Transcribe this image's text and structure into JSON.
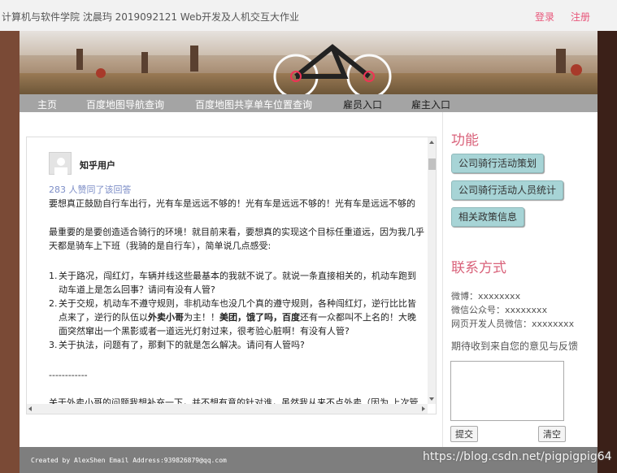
{
  "header": {
    "site_title": "计算机与软件学院 沈晨玙 2019092121 Web开发及人机交互大作业",
    "login": "登录",
    "register": "注册"
  },
  "banner": {
    "image_icon": "cycling-landscape-banner"
  },
  "nav": {
    "items": [
      {
        "label": "主页"
      },
      {
        "label": "百度地图导航查询"
      },
      {
        "label": "百度地图共享单车位置查询"
      },
      {
        "label": "雇员入口"
      },
      {
        "label": "雇主入口"
      }
    ]
  },
  "article": {
    "author": "知乎用户",
    "votes": "283 人赞同了该回答",
    "p1": "要想真正鼓励自行车出行，光有车是远远不够的！光有车是远远不够的！光有车是远远不够的",
    "p2_line1": "最重要的是要创造适合骑行的环境！就目前来看，要想真的实现这个目标任重道远，因为我几乎",
    "p2_line2": "天都是骑车上下班（我骑的是自行车），简单说几点感受:",
    "item1_num": "1.",
    "item1_line1": "关于路况，闯红灯，车辆并线这些最基本的我就不说了。就说一条直接相关的，机动车跑到",
    "item1_line2": "动车道上是怎么回事？请问有没有人管?",
    "item2_num": "2.",
    "item2_line1": "关于交规，机动车不遵守规则，非机动车也没几个真的遵守规则，各种闯红灯，逆行比比皆",
    "item2_line2a": "点来了，逆行的队伍以",
    "item2_line2b": "外卖小哥",
    "item2_line2c": "为主！！",
    "item2_line2d": "美团，饿了吗，百度",
    "item2_line2e": "还有一众都叫不上名的！大晚",
    "item2_line3": "面突然窜出一个黑影或者一道远光灯射过来，很考验心脏啊！有没有人管?",
    "item3_num": "3.",
    "item3_line1": "关于执法，问题有了，那剩下的就是怎么解决。请问有人管吗?",
    "separator": "------------",
    "partial": "关于外卖小哥的问题我想补充一下，并不想有意的针对谁，虽然我从来不点外卖（因为 上次管"
  },
  "sidebar": {
    "functions_title": "功能",
    "buttons": [
      {
        "label": "公司骑行活动策划"
      },
      {
        "label": "公司骑行活动人员统计"
      },
      {
        "label": "相关政策信息"
      }
    ],
    "contact_title": "联系方式",
    "weibo": "微博：xxxxxxxx",
    "wechat_public": "微信公众号：xxxxxxxx",
    "developer_wechat": "网页开发人员微信：xxxxxxxx",
    "feedback_label": "期待收到来自您的意见与反馈",
    "submit": "提交",
    "clear": "清空"
  },
  "footer": {
    "text": "Created by AlexShen Email Address:939826879@qq.com"
  },
  "watermark": "https://blog.csdn.net/pigpigpig64"
}
